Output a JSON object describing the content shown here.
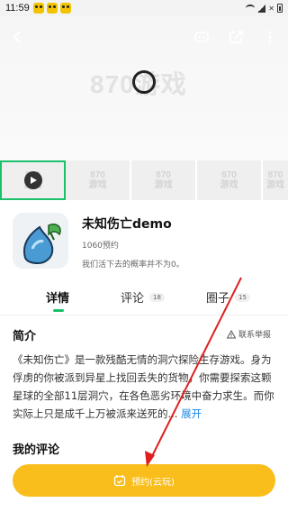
{
  "status_bar": {
    "time": "11:59"
  },
  "hero": {
    "watermark": "870游戏"
  },
  "thumbnails": {
    "watermark_top": "870",
    "watermark_bottom": "游戏"
  },
  "game": {
    "title": "未知伤亡demo",
    "reservations": "1060预约",
    "slogan": "我们活下去的概率并不为0。"
  },
  "tabs": [
    {
      "label": "详情"
    },
    {
      "label": "评论",
      "badge": "18"
    },
    {
      "label": "圈子",
      "badge": "15"
    }
  ],
  "intro": {
    "title": "简介",
    "report_label": "联系举报",
    "text": "《未知伤亡》是一款残酷无情的洞穴探险生存游戏。身为俘虏的你被派到异星上找回丢失的货物，你需要探索这颗星球的全部11层洞穴，在各色恶劣环境中奋力求生。而你实际上只是成千上万被派来送死的...",
    "more_label": "展开"
  },
  "my_review": {
    "title": "我的评论"
  },
  "reserve_button": {
    "label": "预约(云玩)"
  },
  "colors": {
    "accent": "#1bc06a",
    "button": "#f9be1b",
    "link": "#1e88e5",
    "annotation": "#e02020"
  }
}
